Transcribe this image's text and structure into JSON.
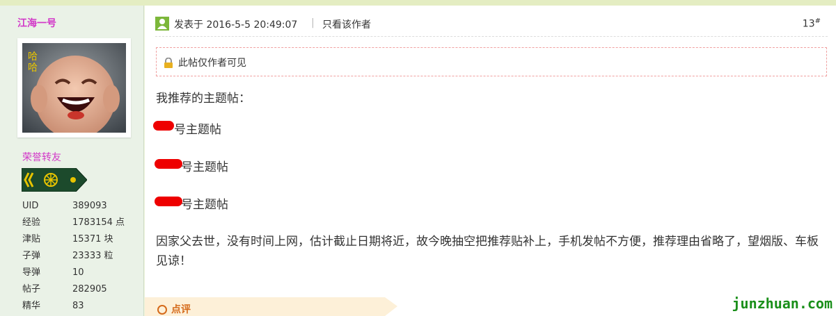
{
  "user": {
    "name": "江海一号",
    "honor": "荣誉转友",
    "stats": [
      {
        "label": "UID",
        "value": "389093"
      },
      {
        "label": "经验",
        "value": "1783154 点"
      },
      {
        "label": "津贴",
        "value": "15371 块"
      },
      {
        "label": "子弹",
        "value": "23333 粒"
      },
      {
        "label": "导弹",
        "value": "10"
      },
      {
        "label": "帖子",
        "value": "282905"
      },
      {
        "label": "精华",
        "value": "83"
      }
    ]
  },
  "post": {
    "time": "发表于 2016-5-5 20:49:07",
    "separator": "|",
    "only_author": "只看该作者",
    "floor": "13",
    "floor_suffix": "#",
    "locked_text": "此帖仅作者可见",
    "recommend_title": "我推荐的主题帖：",
    "topic_suffix": "号主题帖",
    "body": "因家父去世，没有时间上网，估计截止日期将近，故今晚抽空把推荐贴补上，手机发帖不方便，推荐理由省略了，望烟版、车板见谅！",
    "comment_label": "点评"
  },
  "watermark": "junzhuan.com",
  "colors": {
    "username": "#d238c8",
    "redaction": "#ee0000",
    "comment": "#d56a1a",
    "watermark": "#1a8f1a"
  }
}
